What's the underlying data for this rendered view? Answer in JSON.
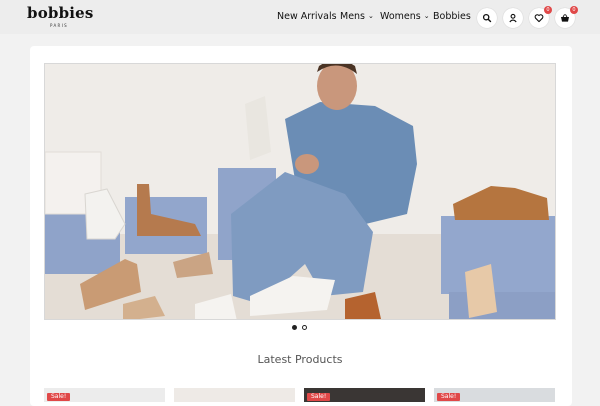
{
  "brand": {
    "name": "bobbies",
    "sub": "PARIS"
  },
  "nav": {
    "new_arrivals": "New Arrivals",
    "mens": "Mens",
    "womens": "Womens",
    "bobbies": "Bobbies"
  },
  "icons": {
    "search": "search-icon",
    "account": "user-icon",
    "wishlist": "heart-icon",
    "cart": "basket-icon"
  },
  "wishlist_count": "0",
  "cart_count": "0",
  "slider": {
    "active_index": 0,
    "total": 2
  },
  "section_title": "Latest Products",
  "products": [
    {
      "badge": "Sale!"
    },
    {
      "badge": ""
    },
    {
      "badge": "Sale!"
    },
    {
      "badge": "Sale!"
    }
  ],
  "colors": {
    "accent": "#e04848",
    "header_bg": "#ededed"
  }
}
